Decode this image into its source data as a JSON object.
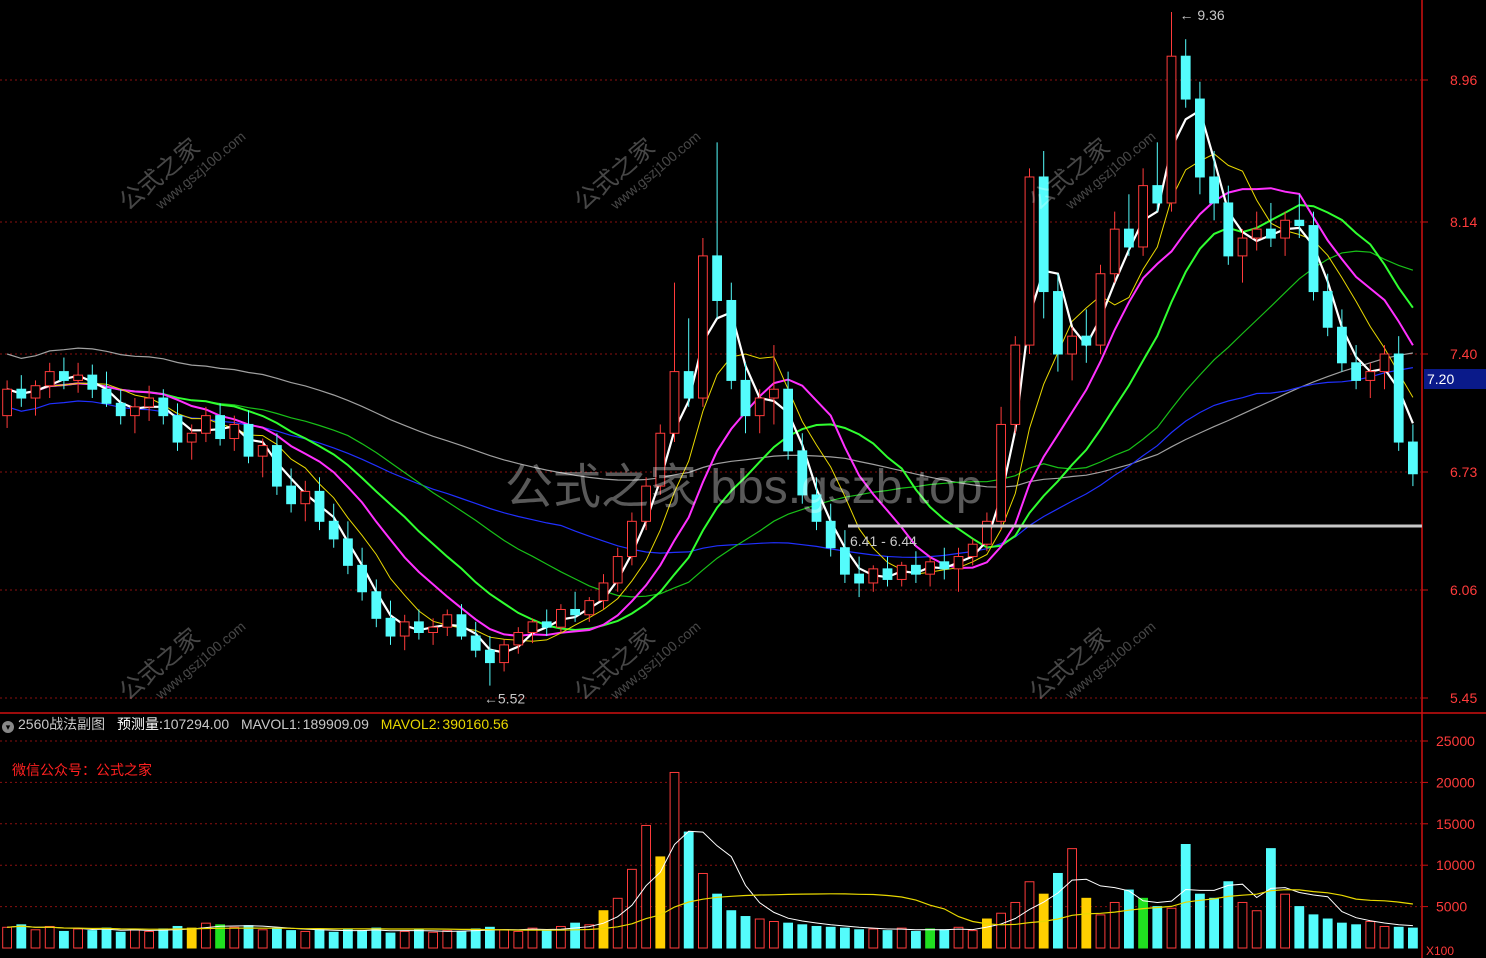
{
  "chart_data": [
    {
      "type": "candlestick",
      "panel": "main",
      "yticks": [
        5.45,
        6.06,
        6.73,
        7.4,
        8.14,
        8.96
      ],
      "ylim": [
        5.45,
        9.36
      ],
      "annotations": {
        "high": "9.36",
        "low": "5.52",
        "range": "6.41 - 6.44",
        "current_price": "7.20"
      },
      "candles_ohlc": [
        [
          7.05,
          7.25,
          6.98,
          7.2
        ],
        [
          7.2,
          7.28,
          7.1,
          7.15
        ],
        [
          7.15,
          7.25,
          7.05,
          7.22
        ],
        [
          7.22,
          7.35,
          7.15,
          7.3
        ],
        [
          7.3,
          7.38,
          7.2,
          7.25
        ],
        [
          7.25,
          7.35,
          7.18,
          7.28
        ],
        [
          7.28,
          7.34,
          7.15,
          7.2
        ],
        [
          7.2,
          7.3,
          7.1,
          7.12
        ],
        [
          7.12,
          7.2,
          7.0,
          7.05
        ],
        [
          7.05,
          7.15,
          6.95,
          7.1
        ],
        [
          7.1,
          7.22,
          7.02,
          7.15
        ],
        [
          7.15,
          7.2,
          7.0,
          7.05
        ],
        [
          7.05,
          7.12,
          6.85,
          6.9
        ],
        [
          6.9,
          7.0,
          6.8,
          6.95
        ],
        [
          6.95,
          7.1,
          6.9,
          7.05
        ],
        [
          7.05,
          7.12,
          6.88,
          6.92
        ],
        [
          6.92,
          7.05,
          6.85,
          7.0
        ],
        [
          7.0,
          7.08,
          6.78,
          6.82
        ],
        [
          6.82,
          6.92,
          6.7,
          6.88
        ],
        [
          6.88,
          6.95,
          6.6,
          6.65
        ],
        [
          6.65,
          6.75,
          6.5,
          6.55
        ],
        [
          6.55,
          6.68,
          6.45,
          6.62
        ],
        [
          6.62,
          6.7,
          6.4,
          6.45
        ],
        [
          6.45,
          6.55,
          6.3,
          6.35
        ],
        [
          6.35,
          6.45,
          6.15,
          6.2
        ],
        [
          6.2,
          6.3,
          6.0,
          6.05
        ],
        [
          6.05,
          6.12,
          5.85,
          5.9
        ],
        [
          5.9,
          6.0,
          5.75,
          5.8
        ],
        [
          5.8,
          5.92,
          5.72,
          5.88
        ],
        [
          5.88,
          5.95,
          5.78,
          5.82
        ],
        [
          5.82,
          5.9,
          5.75,
          5.85
        ],
        [
          5.85,
          5.95,
          5.8,
          5.92
        ],
        [
          5.92,
          5.98,
          5.78,
          5.8
        ],
        [
          5.8,
          5.88,
          5.68,
          5.72
        ],
        [
          5.72,
          5.8,
          5.52,
          5.65
        ],
        [
          5.65,
          5.78,
          5.6,
          5.75
        ],
        [
          5.75,
          5.85,
          5.7,
          5.82
        ],
        [
          5.82,
          5.9,
          5.76,
          5.88
        ],
        [
          5.88,
          5.95,
          5.8,
          5.85
        ],
        [
          5.85,
          5.98,
          5.82,
          5.95
        ],
        [
          5.95,
          6.05,
          5.88,
          5.92
        ],
        [
          5.92,
          6.02,
          5.88,
          6.0
        ],
        [
          6.0,
          6.15,
          5.95,
          6.1
        ],
        [
          6.1,
          6.3,
          6.05,
          6.25
        ],
        [
          6.25,
          6.5,
          6.2,
          6.45
        ],
        [
          6.45,
          6.7,
          6.4,
          6.65
        ],
        [
          6.65,
          7.0,
          6.6,
          6.95
        ],
        [
          6.95,
          7.8,
          6.9,
          7.3
        ],
        [
          7.3,
          7.6,
          7.1,
          7.15
        ],
        [
          7.15,
          8.05,
          7.1,
          7.95
        ],
        [
          7.95,
          8.6,
          7.6,
          7.7
        ],
        [
          7.7,
          7.8,
          7.2,
          7.25
        ],
        [
          7.25,
          7.35,
          6.95,
          7.05
        ],
        [
          7.05,
          7.2,
          6.95,
          7.15
        ],
        [
          7.15,
          7.45,
          7.0,
          7.2
        ],
        [
          7.2,
          7.3,
          6.8,
          6.85
        ],
        [
          6.85,
          6.95,
          6.55,
          6.6
        ],
        [
          6.6,
          6.7,
          6.4,
          6.45
        ],
        [
          6.45,
          6.55,
          6.25,
          6.3
        ],
        [
          6.3,
          6.4,
          6.1,
          6.15
        ],
        [
          6.15,
          6.25,
          6.02,
          6.1
        ],
        [
          6.1,
          6.2,
          6.05,
          6.18
        ],
        [
          6.18,
          6.25,
          6.08,
          6.12
        ],
        [
          6.12,
          6.22,
          6.08,
          6.2
        ],
        [
          6.2,
          6.28,
          6.1,
          6.15
        ],
        [
          6.15,
          6.25,
          6.08,
          6.22
        ],
        [
          6.22,
          6.3,
          6.12,
          6.18
        ],
        [
          6.18,
          6.3,
          6.05,
          6.25
        ],
        [
          6.25,
          6.35,
          6.2,
          6.32
        ],
        [
          6.32,
          6.5,
          6.28,
          6.45
        ],
        [
          6.45,
          7.1,
          6.4,
          7.0
        ],
        [
          7.0,
          7.5,
          6.95,
          7.45
        ],
        [
          7.45,
          8.45,
          7.4,
          8.4
        ],
        [
          8.4,
          8.55,
          7.6,
          7.75
        ],
        [
          7.75,
          7.85,
          7.3,
          7.4
        ],
        [
          7.4,
          7.55,
          7.25,
          7.5
        ],
        [
          7.5,
          7.65,
          7.35,
          7.45
        ],
        [
          7.45,
          7.9,
          7.4,
          7.85
        ],
        [
          7.85,
          8.2,
          7.8,
          8.1
        ],
        [
          8.1,
          8.3,
          7.95,
          8.0
        ],
        [
          8.0,
          8.45,
          7.95,
          8.35
        ],
        [
          8.35,
          8.6,
          8.2,
          8.25
        ],
        [
          8.25,
          9.36,
          8.2,
          9.1
        ],
        [
          9.1,
          9.2,
          8.8,
          8.85
        ],
        [
          8.85,
          8.95,
          8.3,
          8.4
        ],
        [
          8.4,
          8.55,
          8.15,
          8.25
        ],
        [
          8.25,
          8.35,
          7.9,
          7.95
        ],
        [
          7.95,
          8.1,
          7.8,
          8.05
        ],
        [
          8.05,
          8.2,
          7.98,
          8.1
        ],
        [
          8.1,
          8.25,
          8.0,
          8.05
        ],
        [
          8.05,
          8.2,
          7.95,
          8.15
        ],
        [
          8.15,
          8.3,
          8.05,
          8.12
        ],
        [
          8.12,
          8.2,
          7.7,
          7.75
        ],
        [
          7.75,
          7.85,
          7.5,
          7.55
        ],
        [
          7.55,
          7.65,
          7.3,
          7.35
        ],
        [
          7.35,
          7.45,
          7.2,
          7.25
        ],
        [
          7.25,
          7.35,
          7.15,
          7.3
        ],
        [
          7.3,
          7.45,
          7.2,
          7.4
        ],
        [
          7.4,
          7.5,
          6.85,
          6.9
        ],
        [
          6.9,
          7.0,
          6.65,
          6.72
        ]
      ]
    },
    {
      "type": "bar",
      "panel": "volume",
      "yticks": [
        5000,
        10000,
        15000,
        20000,
        25000
      ],
      "unit": "X100",
      "volumes": [
        2500,
        2800,
        2200,
        2600,
        2000,
        2300,
        2100,
        2400,
        1900,
        2200,
        2000,
        2300,
        2600,
        2400,
        3000,
        2800,
        2500,
        2700,
        2200,
        2400,
        2100,
        2000,
        2300,
        1900,
        2200,
        2100,
        2400,
        1800,
        2000,
        2200,
        1900,
        2100,
        2000,
        2300,
        2500,
        2200,
        2000,
        2400,
        2100,
        2600,
        3000,
        2800,
        4500,
        6000,
        9500,
        14800,
        11000,
        21200,
        14000,
        9000,
        6500,
        4500,
        3800,
        3500,
        3200,
        3000,
        2800,
        2600,
        2500,
        2400,
        2200,
        2300,
        2100,
        2400,
        2000,
        2300,
        2200,
        2500,
        2100,
        3500,
        4200,
        5500,
        8000,
        6500,
        9000,
        12000,
        6000,
        4000,
        5500,
        7000,
        6000,
        5000,
        4800,
        12500,
        6500,
        6000,
        8000,
        5500,
        4500,
        12000,
        6500,
        5000,
        4000,
        3500,
        3000,
        2800,
        3200,
        2600,
        2500,
        2400
      ]
    }
  ],
  "header": {
    "indicator_name": "2560战法副图",
    "forecast_label": "预测量:",
    "forecast_value": "107294.00",
    "mavol1_label": "MAVOL1:",
    "mavol1_value": "189909.09",
    "mavol2_label": "MAVOL2:",
    "mavol2_value": "390160.56"
  },
  "wechat_label": "微信公众号：公式之家",
  "watermark_center": "公式之家 bbs.gszb.top",
  "watermark_diag_cn": "公式之家",
  "watermark_diag_url": "www.gszj100.com",
  "colors": {
    "up": "#ff3b3b",
    "down": "#54fcfc",
    "ma5": "#ffffff",
    "ma10": "#e8d800",
    "ma20": "#ff30ff",
    "ma30": "#30ff30",
    "ma60": "#18c018",
    "ma120": "#2030ff",
    "ma250": "#a0a0a0",
    "axis": "#d01010"
  }
}
